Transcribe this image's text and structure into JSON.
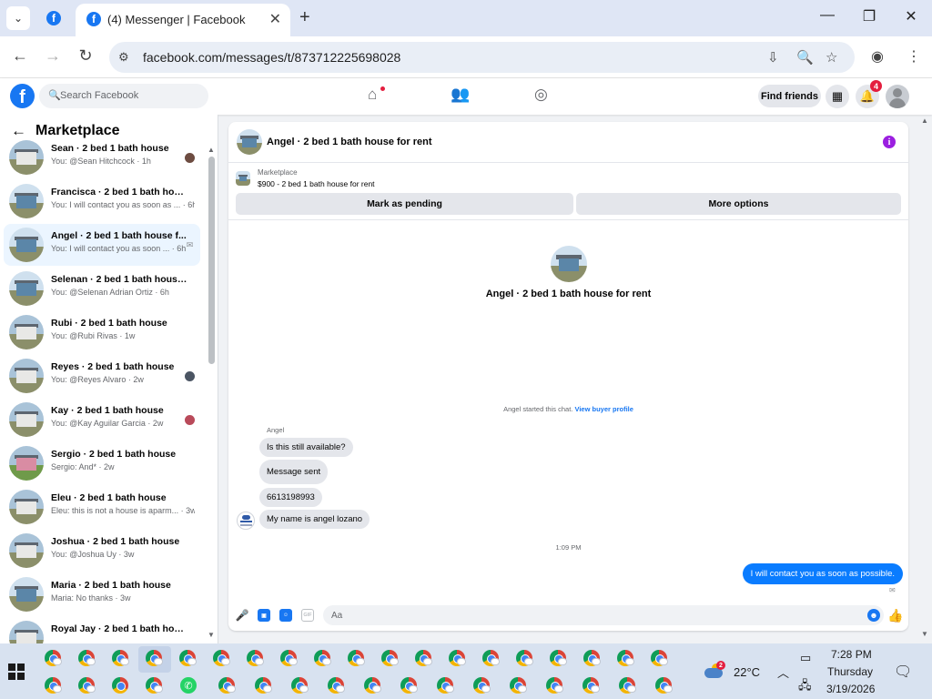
{
  "browser": {
    "tab_title": "(4) Messenger | Facebook",
    "url": "facebook.com/messages/t/873712225698028",
    "tab_close": "✕",
    "new_tab": "+"
  },
  "facebook": {
    "search_placeholder": "Search Facebook",
    "find_friends": "Find friends",
    "notification_count": "4"
  },
  "sidebar": {
    "title": "Marketplace",
    "conversations": [
      {
        "name": "Sean · 2 bed 1 bath house",
        "preview": "You: @Sean Hitchcock · 1h",
        "seen": "avatar"
      },
      {
        "name": "Francisca · 2 bed 1 bath house f...",
        "preview": "You: I will contact you as soon as ... · 6h",
        "seen": "none"
      },
      {
        "name": "Angel · 2 bed 1 bath house f...",
        "preview": "You: I will contact you as soon ... · 6h",
        "seen": "sent"
      },
      {
        "name": "Selenan · 2 bed 1 bath house fo...",
        "preview": "You: @Selenan Adrian Ortiz · 6h",
        "seen": "none"
      },
      {
        "name": "Rubi · 2 bed 1 bath house",
        "preview": "You: @Rubi Rivas · 1w",
        "seen": "none"
      },
      {
        "name": "Reyes · 2 bed 1 bath house",
        "preview": "You: @Reyes Alvaro · 2w",
        "seen": "avatar"
      },
      {
        "name": "Kay · 2 bed 1 bath house",
        "preview": "You: @Kay Aguilar Garcia · 2w",
        "seen": "avatar"
      },
      {
        "name": "Sergio · 2 bed 1 bath house",
        "preview": "Sergio: And* · 2w",
        "seen": "none"
      },
      {
        "name": "Eleu · 2 bed 1 bath house",
        "preview": "Eleu: this is not a house is aparm... · 3w",
        "seen": "none"
      },
      {
        "name": "Joshua · 2 bed 1 bath house",
        "preview": "You: @Joshua Uy · 3w",
        "seen": "none"
      },
      {
        "name": "Maria · 2 bed 1 bath house",
        "preview": "Maria: No thanks · 3w",
        "seen": "none"
      },
      {
        "name": "Royal Jay · 2 bed 1 bath house",
        "preview": "",
        "seen": "none"
      }
    ]
  },
  "chat": {
    "header_title": "Angel · 2 bed 1 bath house for rent",
    "marketplace_label": "Marketplace",
    "listing": "$900 - 2 bed 1 bath house for rent",
    "mark_pending": "Mark as pending",
    "more_options": "More options",
    "intro_title": "Angel · 2 bed 1 bath house for rent",
    "started_text": "Angel started this chat.",
    "view_profile": "View buyer profile",
    "sender": "Angel",
    "incoming": [
      "Is this still available?",
      "Message sent",
      "6613198993",
      "My name is angel lozano"
    ],
    "timestamp": "1:09 PM",
    "outgoing": "I will contact you as soon as possible.",
    "input_placeholder": "Aa",
    "gif_label": "GIF"
  },
  "taskbar": {
    "temperature": "22°C",
    "weather_badge": "2",
    "time": "7:28 PM",
    "day": "Thursday",
    "date": "3/19/2026"
  }
}
